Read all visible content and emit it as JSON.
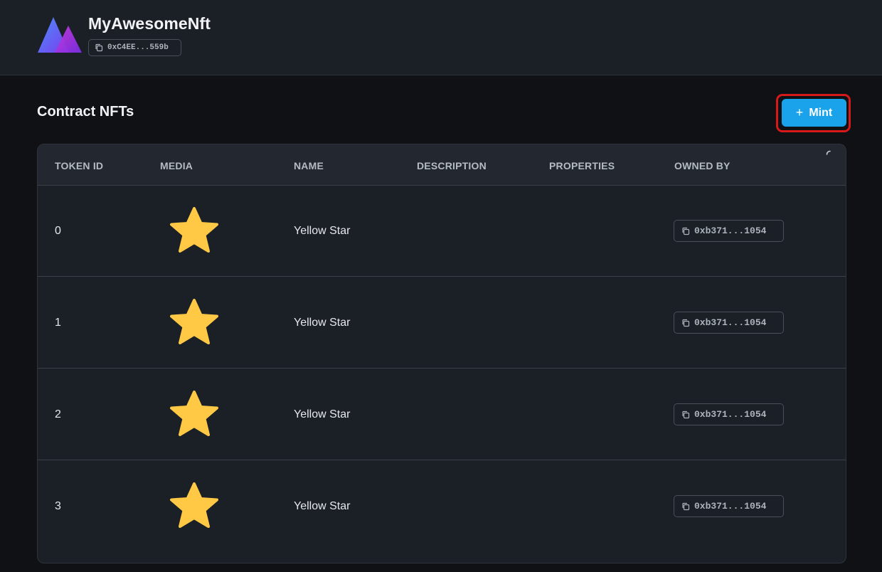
{
  "header": {
    "contract_name": "MyAwesomeNft",
    "contract_address": "0xC4EE...559b"
  },
  "main": {
    "section_title": "Contract NFTs",
    "mint_button": {
      "label": "Mint",
      "icon": "plus-icon"
    }
  },
  "table": {
    "columns": [
      "TOKEN ID",
      "MEDIA",
      "NAME",
      "DESCRIPTION",
      "PROPERTIES",
      "OWNED BY"
    ],
    "rows": [
      {
        "token_id": "0",
        "media": "star-icon",
        "name": "Yellow Star",
        "description": "",
        "properties": "",
        "owner": "0xb371...1054"
      },
      {
        "token_id": "1",
        "media": "star-icon",
        "name": "Yellow Star",
        "description": "",
        "properties": "",
        "owner": "0xb371...1054"
      },
      {
        "token_id": "2",
        "media": "star-icon",
        "name": "Yellow Star",
        "description": "",
        "properties": "",
        "owner": "0xb371...1054"
      },
      {
        "token_id": "3",
        "media": "star-icon",
        "name": "Yellow Star",
        "description": "",
        "properties": "",
        "owner": "0xb371...1054"
      }
    ]
  },
  "colors": {
    "accent": "#1aa3ea",
    "highlight": "#d61919",
    "star": "#ffc845",
    "background": "#0f1115",
    "surface": "#1b1f26"
  }
}
